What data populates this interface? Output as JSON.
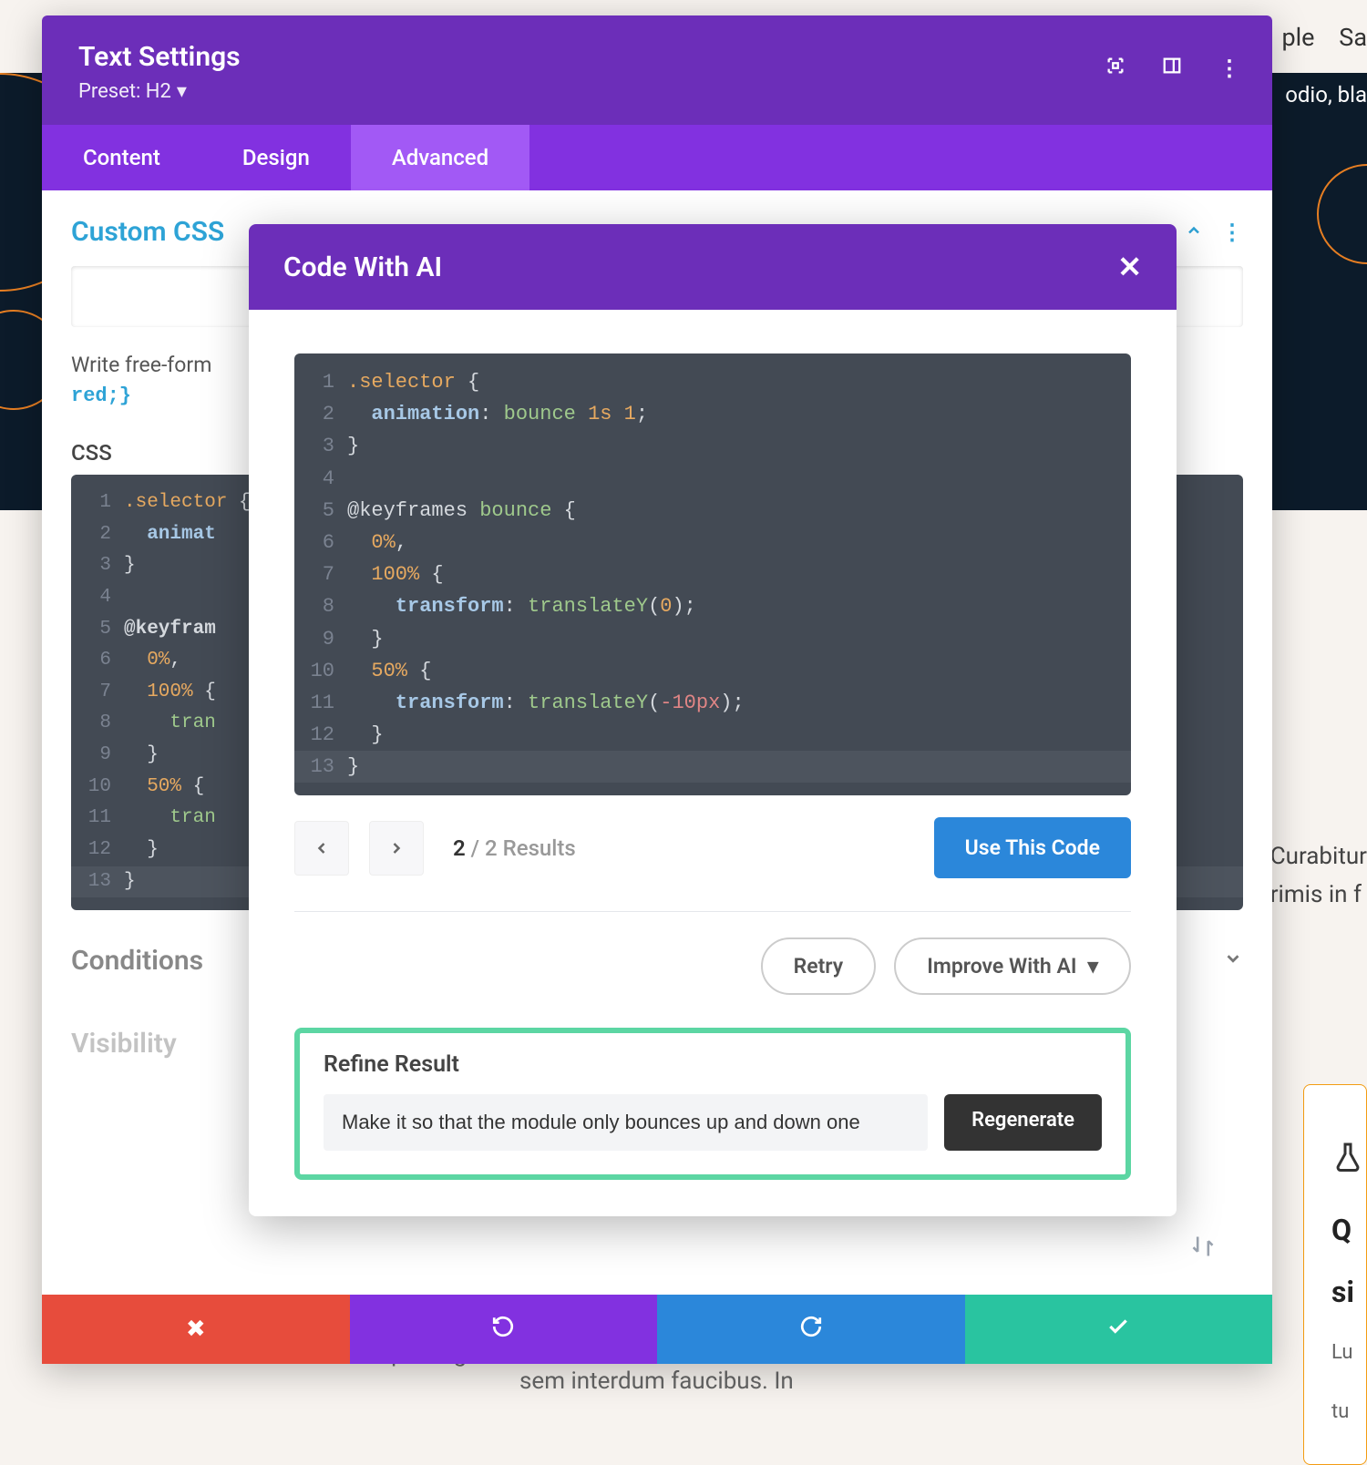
{
  "bg": {
    "top_right_nav_partial": "ple",
    "top_right_nav_partial2": "Sa",
    "hero_partial": "odio, bla",
    "blurb_line1": "Curabitur",
    "blurb_line2": "rimis in f",
    "card_title1": "Q",
    "card_title2": "si",
    "card_body1": "Lu",
    "card_body2": "tu",
    "bottom_partial": "consectetur adipiscing elit",
    "bottom_partial2": "sem interdum faucibus. In"
  },
  "panel": {
    "title": "Text Settings",
    "preset": "Preset: H2",
    "tabs": {
      "content": "Content",
      "design": "Design",
      "advanced": "Advanced"
    },
    "section_title": "Custom CSS",
    "helper_text": "Write free-form",
    "helper_code": "red;}",
    "css_label": "CSS",
    "bg_code_lines": [
      {
        "n": "1",
        "sel": ".selector",
        "rest": " {"
      },
      {
        "n": "2",
        "prop": "  animat"
      },
      {
        "n": "3",
        "punc": "}"
      },
      {
        "n": "4",
        "punc": ""
      },
      {
        "n": "5",
        "kw": "@keyfram"
      },
      {
        "n": "6",
        "num": "  0%",
        "rest": ","
      },
      {
        "n": "7",
        "num": "  100%",
        "rest": " {"
      },
      {
        "n": "8",
        "val": "    tran"
      },
      {
        "n": "9",
        "punc": "  }"
      },
      {
        "n": "10",
        "num": "  50%",
        "rest": " {"
      },
      {
        "n": "11",
        "val": "    tran"
      },
      {
        "n": "12",
        "punc": "  }"
      },
      {
        "n": "13",
        "punc": "}"
      }
    ],
    "conditions": "Conditions",
    "visibility": "Visibility"
  },
  "ai": {
    "title": "Code With AI",
    "code_lines": [
      {
        "n": "1",
        "html": "<span class='c-sel'>.selector</span> <span class='c-punc'>{</span>"
      },
      {
        "n": "2",
        "html": "  <span class='c-prop'>animation</span><span class='c-punc'>:</span> <span class='c-val'>bounce</span> <span class='c-num'>1s</span> <span class='c-num'>1</span><span class='c-punc'>;</span>"
      },
      {
        "n": "3",
        "html": "<span class='c-punc'>}</span>"
      },
      {
        "n": "4",
        "html": ""
      },
      {
        "n": "5",
        "html": "<span class='c-punc'>@keyframes</span> <span class='c-val'>bounce</span> <span class='c-punc'>{</span>"
      },
      {
        "n": "6",
        "html": "  <span class='c-num'>0%</span><span class='c-punc'>,</span>"
      },
      {
        "n": "7",
        "html": "  <span class='c-num'>100%</span> <span class='c-punc'>{</span>"
      },
      {
        "n": "8",
        "html": "    <span class='c-prop'>transform</span><span class='c-punc'>:</span> <span class='c-val'>translateY</span><span class='c-punc'>(</span><span class='c-num'>0</span><span class='c-punc'>);</span>"
      },
      {
        "n": "9",
        "html": "  <span class='c-punc'>}</span>"
      },
      {
        "n": "10",
        "html": "  <span class='c-num'>50%</span> <span class='c-punc'>{</span>"
      },
      {
        "n": "11",
        "html": "    <span class='c-prop'>transform</span><span class='c-punc'>:</span> <span class='c-val'>translateY</span><span class='c-punc'>(</span><span class='c-neg'>-10px</span><span class='c-punc'>);</span>"
      },
      {
        "n": "12",
        "html": "  <span class='c-punc'>}</span>"
      },
      {
        "n": "13",
        "html": "<span class='c-punc'>}</span>",
        "hl": true
      }
    ],
    "results_current": "2",
    "results_sep": " / ",
    "results_total": "2 Results",
    "use_btn": "Use This Code",
    "retry": "Retry",
    "improve": "Improve With AI",
    "refine_title": "Refine Result",
    "refine_input": "Make it so that the module only bounces up and down one",
    "regenerate": "Regenerate"
  }
}
